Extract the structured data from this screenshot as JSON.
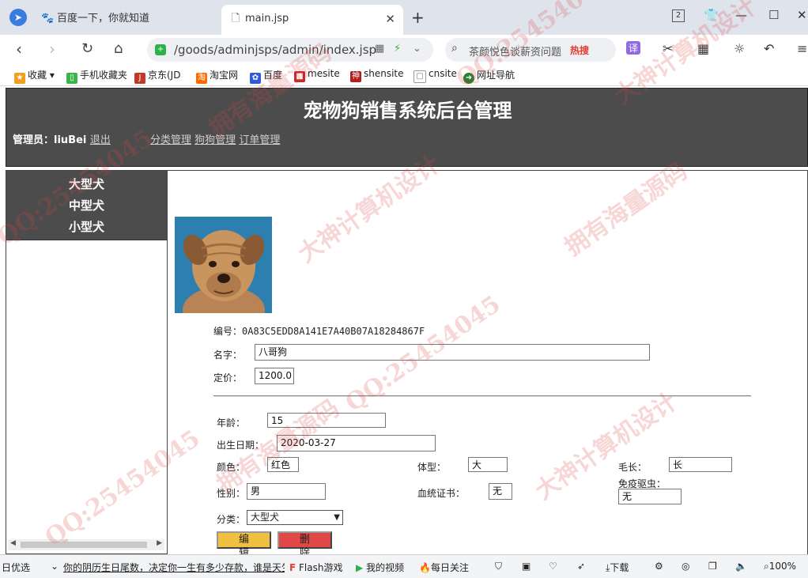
{
  "browser": {
    "tabs": [
      {
        "icon": "paw-icon",
        "label": "百度一下，你就知道"
      },
      {
        "icon": "document-icon",
        "label": "main.jsp"
      }
    ],
    "tab_count_badge": "2",
    "address": "/goods/adminjsps/admin/index.jsp",
    "search_placeholder": "茶颜悦色谈薪资问题",
    "search_hot": "热搜",
    "translate_label": "译",
    "bookmarks": [
      {
        "icon": "star-icon",
        "label": "收藏",
        "color": "#f0a020"
      },
      {
        "icon": "phone-icon",
        "label": "手机收藏夹",
        "color": "#39b54a"
      },
      {
        "icon": "jd-icon",
        "label": "京东(JD",
        "color": "#c0392b"
      },
      {
        "icon": "taobao-icon",
        "label": "淘宝网",
        "color": "#ff6a00"
      },
      {
        "icon": "paw-icon",
        "label": "百度",
        "color": "#2f5bd8"
      },
      {
        "icon": "mesite-icon",
        "label": "mesite",
        "color": "#c62828"
      },
      {
        "icon": "shensite-icon",
        "label": "shensite",
        "color": "#b71c1c"
      },
      {
        "icon": "cnsite-icon",
        "label": "cnsite",
        "color": "#777777"
      },
      {
        "icon": "navigation-icon",
        "label": "网址导航",
        "color": "#2e7d32"
      }
    ]
  },
  "header": {
    "title": "宠物狗销售系统后台管理",
    "admin_prefix": "管理员：",
    "admin_name": "liuBei",
    "logout": "退出",
    "nav": [
      "分类管理",
      "狗狗管理",
      "订单管理"
    ]
  },
  "sidebar": {
    "categories": [
      "大型犬",
      "中型犬",
      "小型犬"
    ]
  },
  "dog": {
    "id_label": "编号：",
    "id_value": "0A83C5EDD8A141E7A40B07A18284867F",
    "name_label": "名字：",
    "name_value": "八哥狗",
    "price_label": "定价：",
    "price_value": "1200.0",
    "age_label": "年龄：",
    "age_value": "15",
    "birth_label": "出生日期：",
    "birth_value": "2020-03-27",
    "color_label": "颜色：",
    "color_value": "红色",
    "size_label": "体型：",
    "size_value": "大",
    "fur_label": "毛长：",
    "fur_value": "长",
    "gender_label": "性别：",
    "gender_value": "男",
    "pedigree_label": "血统证书：",
    "pedigree_value": "无",
    "deworm_label": "免疫驱虫：",
    "deworm_value": "无",
    "category_label": "分类：",
    "category_value": "大型犬",
    "edit_button": "编辑",
    "delete_button": "删除"
  },
  "statusbar": {
    "left": "日优选",
    "news": "你的阴历生日尾数，决定你一生有多少存款，谁是天生",
    "flash": "Flash游戏",
    "video": "我的视频",
    "daily": "每日关注",
    "download": "下载",
    "zoom": "100%"
  },
  "watermarks": [
    "QQ:25454045",
    "大神计算机设计",
    "拥有海量源码",
    "QQ:25454045",
    "大神计算机设计",
    "拥有海量源码",
    "QQ:25454045",
    "大神计算机设计",
    "QQ:25454045",
    "拥有海量源码"
  ]
}
